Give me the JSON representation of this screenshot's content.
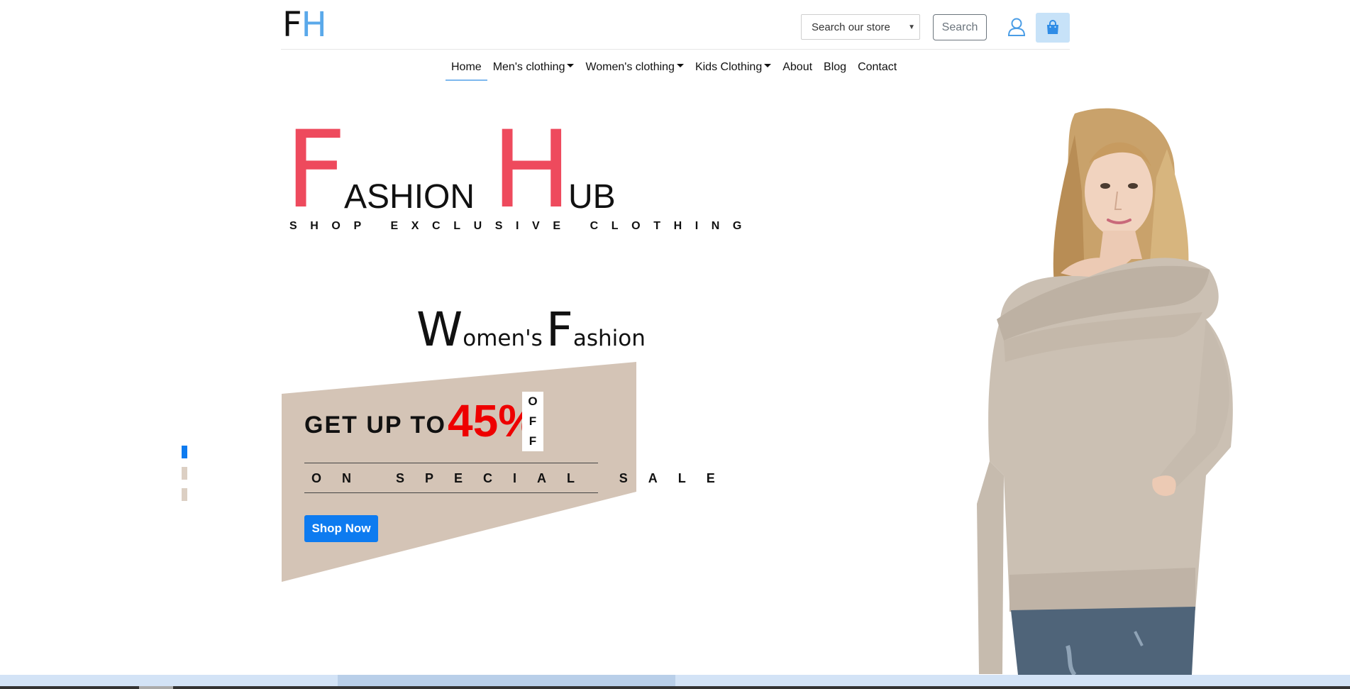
{
  "logo": {
    "f": "F",
    "h": "H"
  },
  "header": {
    "store_select": "Search our store",
    "search_button": "Search"
  },
  "nav": {
    "items": [
      {
        "label": "Home",
        "dropdown": false
      },
      {
        "label": "Men's clothing",
        "dropdown": true
      },
      {
        "label": "Women's clothing",
        "dropdown": true
      },
      {
        "label": "Kids Clothing",
        "dropdown": true
      },
      {
        "label": "About",
        "dropdown": false
      },
      {
        "label": "Blog",
        "dropdown": false
      },
      {
        "label": "Contact",
        "dropdown": false
      }
    ]
  },
  "hero": {
    "brand": {
      "f": "F",
      "ashion": "ASHION",
      "h": "H",
      "ub": "UB"
    },
    "tagline": "SHOP EXCLUSIVE CLOTHING",
    "collection": {
      "w": "W",
      "omens": "omen's",
      "f": "F",
      "ashion": "ashion"
    },
    "promo": {
      "get_up_to": "GET UP TO",
      "percent": "45%",
      "off": [
        "O",
        "F",
        "F"
      ],
      "special_sale": "ON SPECIAL SALE",
      "shop_now": "Shop Now"
    },
    "carousel_slides": 3,
    "active_slide": 0
  },
  "colors": {
    "brand_red": "#ee4a5d",
    "logo_blue": "#5aa9ea",
    "promo_bg": "#d4c4b6",
    "sale_red": "#ee0000",
    "primary": "#0d7bf0"
  },
  "icons": [
    "user-icon",
    "shopping-bag-icon",
    "caret-down-icon"
  ]
}
